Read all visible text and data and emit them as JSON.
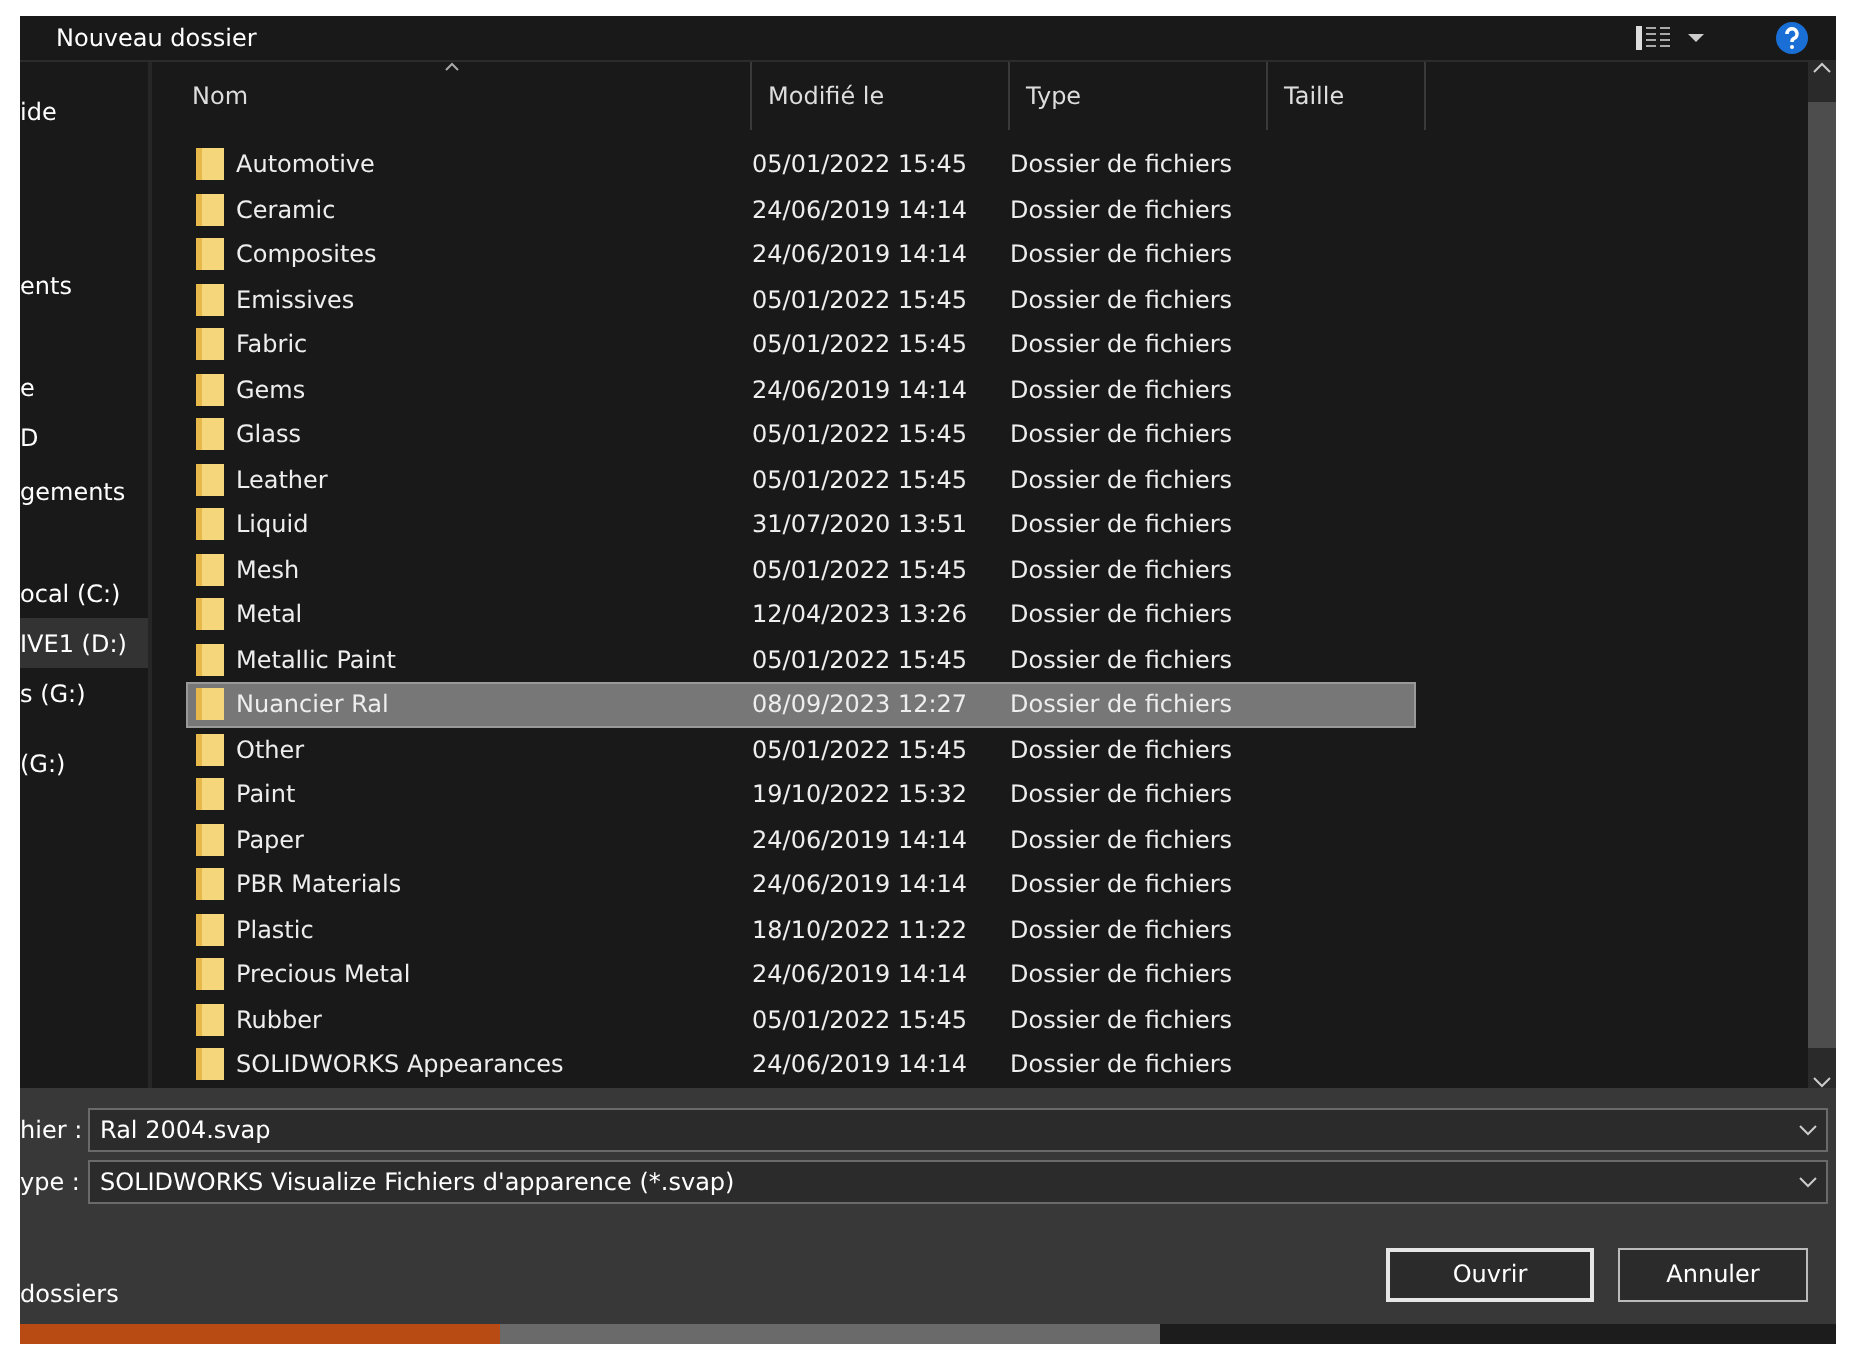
{
  "toolbar": {
    "new_folder": "Nouveau dossier"
  },
  "sidebar": {
    "items": [
      {
        "label": "ide",
        "selected": false
      },
      {
        "label": "ents",
        "selected": false
      },
      {
        "label": "e",
        "selected": false
      },
      {
        "label": "D",
        "selected": false
      },
      {
        "label": "gements",
        "selected": false
      },
      {
        "label": "ocal (C:)",
        "selected": false
      },
      {
        "label": "IVE1 (D:)",
        "selected": true
      },
      {
        "label": "s (G:)",
        "selected": false
      },
      {
        "label": "(G:)",
        "selected": false
      }
    ]
  },
  "table": {
    "columns": [
      "Nom",
      "Modifié le",
      "Type",
      "Taille"
    ],
    "rows": [
      {
        "name": "Automotive",
        "modified": "05/01/2022 15:45",
        "type": "Dossier de fichiers",
        "selected": false
      },
      {
        "name": "Ceramic",
        "modified": "24/06/2019 14:14",
        "type": "Dossier de fichiers",
        "selected": false
      },
      {
        "name": "Composites",
        "modified": "24/06/2019 14:14",
        "type": "Dossier de fichiers",
        "selected": false
      },
      {
        "name": "Emissives",
        "modified": "05/01/2022 15:45",
        "type": "Dossier de fichiers",
        "selected": false
      },
      {
        "name": "Fabric",
        "modified": "05/01/2022 15:45",
        "type": "Dossier de fichiers",
        "selected": false
      },
      {
        "name": "Gems",
        "modified": "24/06/2019 14:14",
        "type": "Dossier de fichiers",
        "selected": false
      },
      {
        "name": "Glass",
        "modified": "05/01/2022 15:45",
        "type": "Dossier de fichiers",
        "selected": false
      },
      {
        "name": "Leather",
        "modified": "05/01/2022 15:45",
        "type": "Dossier de fichiers",
        "selected": false
      },
      {
        "name": "Liquid",
        "modified": "31/07/2020 13:51",
        "type": "Dossier de fichiers",
        "selected": false
      },
      {
        "name": "Mesh",
        "modified": "05/01/2022 15:45",
        "type": "Dossier de fichiers",
        "selected": false
      },
      {
        "name": "Metal",
        "modified": "12/04/2023 13:26",
        "type": "Dossier de fichiers",
        "selected": false
      },
      {
        "name": "Metallic Paint",
        "modified": "05/01/2022 15:45",
        "type": "Dossier de fichiers",
        "selected": false
      },
      {
        "name": "Nuancier Ral",
        "modified": "08/09/2023 12:27",
        "type": "Dossier de fichiers",
        "selected": true
      },
      {
        "name": "Other",
        "modified": "05/01/2022 15:45",
        "type": "Dossier de fichiers",
        "selected": false
      },
      {
        "name": "Paint",
        "modified": "19/10/2022 15:32",
        "type": "Dossier de fichiers",
        "selected": false
      },
      {
        "name": "Paper",
        "modified": "24/06/2019 14:14",
        "type": "Dossier de fichiers",
        "selected": false
      },
      {
        "name": "PBR Materials",
        "modified": "24/06/2019 14:14",
        "type": "Dossier de fichiers",
        "selected": false
      },
      {
        "name": "Plastic",
        "modified": "18/10/2022 11:22",
        "type": "Dossier de fichiers",
        "selected": false
      },
      {
        "name": "Precious Metal",
        "modified": "24/06/2019 14:14",
        "type": "Dossier de fichiers",
        "selected": false
      },
      {
        "name": "Rubber",
        "modified": "05/01/2022 15:45",
        "type": "Dossier de fichiers",
        "selected": false
      },
      {
        "name": "SOLIDWORKS Appearances",
        "modified": "24/06/2019 14:14",
        "type": "Dossier de fichiers",
        "selected": false
      }
    ]
  },
  "filename": {
    "label": "hier :",
    "value": "Ral 2004.svap"
  },
  "filetype": {
    "label": "ype :",
    "value": "SOLIDWORKS Visualize Fichiers d'apparence (*.svap)"
  },
  "hide_folders": "dossiers",
  "buttons": [
    {
      "label": "Ouvrir",
      "default": true
    },
    {
      "label": "Annuler",
      "default": false
    }
  ]
}
